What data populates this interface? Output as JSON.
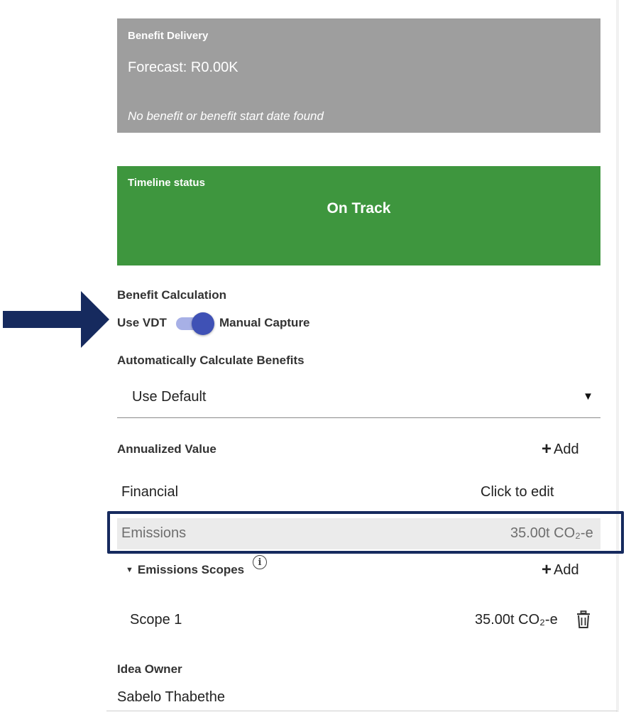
{
  "benefit_delivery": {
    "title": "Benefit Delivery",
    "forecast": "Forecast: R0.00K",
    "note": "No benefit or benefit start date found",
    "color": "#9e9e9e"
  },
  "timeline": {
    "title": "Timeline status",
    "status": "On Track",
    "color": "#3e963e"
  },
  "benefit_calculation": {
    "label": "Benefit Calculation",
    "left_option": "Use VDT",
    "right_option": "Manual Capture",
    "toggle_on": true,
    "toggle_color": "#3f51b5"
  },
  "auto_calc": {
    "label": "Automatically Calculate Benefits",
    "selected": "Use Default",
    "caret": "▼"
  },
  "annualized": {
    "label": "Annualized Value",
    "add_label": "Add",
    "rows": [
      {
        "name": "Financial",
        "value": "Click to edit"
      },
      {
        "name": "Emissions",
        "value": "35.00t CO₂-e"
      }
    ]
  },
  "emissions_scopes": {
    "label": "Emissions Scopes",
    "add_label": "Add",
    "info_icon": "ⓘ",
    "rows": [
      {
        "name": "Scope 1",
        "value": "35.00t CO₂-e"
      }
    ]
  },
  "idea_owner": {
    "label": "Idea Owner",
    "name": "Sabelo Thabethe"
  },
  "icons": {
    "arrow": "right-arrow",
    "trash": "trash-icon",
    "info": "info-icon"
  },
  "highlight_color": "#162a5e"
}
